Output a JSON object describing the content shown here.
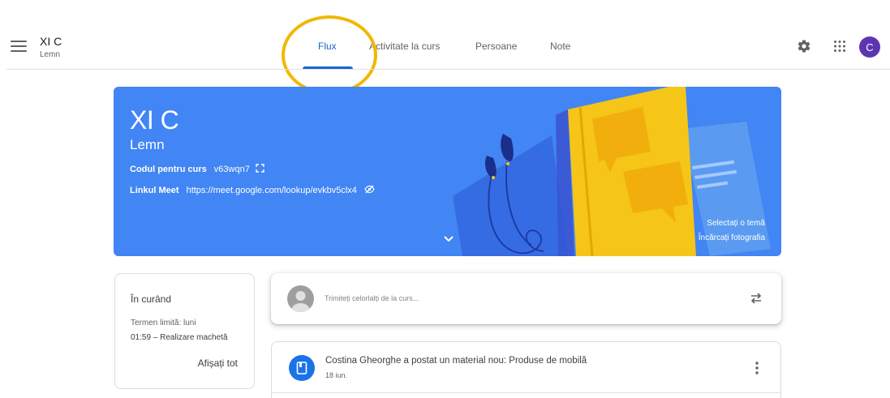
{
  "header": {
    "class_name": "XI C",
    "class_section": "Lemn",
    "tabs": [
      {
        "label": "Flux",
        "active": true
      },
      {
        "label": "Activitate la curs",
        "active": false
      },
      {
        "label": "Persoane",
        "active": false
      },
      {
        "label": "Note",
        "active": false
      }
    ],
    "icons": [
      "menu-icon",
      "settings-gear-icon",
      "apps-grid-icon"
    ],
    "avatar_letter": "C",
    "accent_color": "#1967d2"
  },
  "banner": {
    "title": "XI C",
    "section": "Lemn",
    "code_label": "Codul pentru curs",
    "code_value": "v63wqn7",
    "meet_label": "Linkul Meet",
    "meet_value": "https://meet.google.com/lookup/evkbv5clx4",
    "select_theme": "Selectați o temă",
    "upload_photo": "Încărcați fotografia",
    "background_color": "#4285f4"
  },
  "upcoming": {
    "title": "În curând",
    "due_label": "Termen limită: luni",
    "item": "01:59 – Realizare machetă",
    "view_all": "Afișați tot"
  },
  "compose": {
    "placeholder": "Trimiteți celorlalți de la curs..."
  },
  "posts": [
    {
      "title": "Costina Gheorghe a postat un material nou: Produse de mobilă",
      "date": "18 iun."
    }
  ]
}
